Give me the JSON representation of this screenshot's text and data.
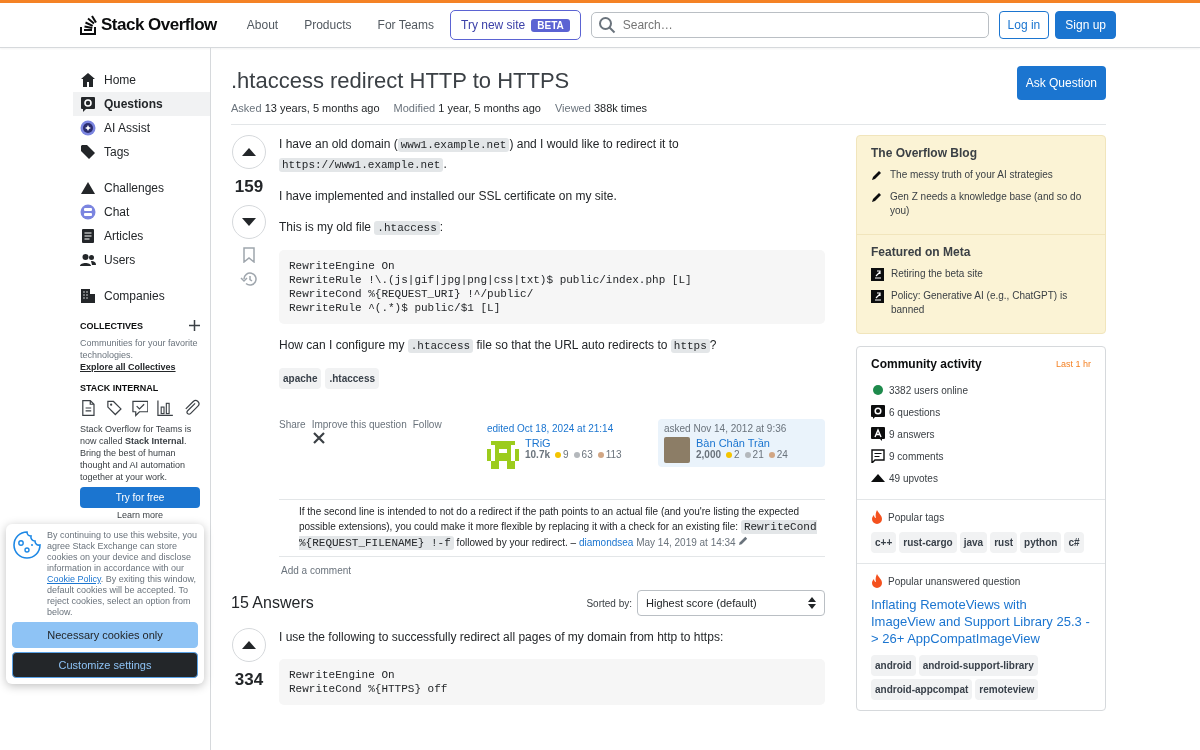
{
  "topbar": {
    "logo": "Stack Overflow",
    "nav": [
      "About",
      "Products",
      "For Teams"
    ],
    "try_button": {
      "label": "Try new site",
      "badge": "BETA"
    },
    "search": {
      "placeholder": "Search…"
    },
    "login": "Log in",
    "signup": "Sign up"
  },
  "sidebar": {
    "groups": [
      [
        {
          "kind": "home",
          "label": "Home",
          "selected": false
        },
        {
          "kind": "questions",
          "label": "Questions",
          "selected": true
        },
        {
          "kind": "ai",
          "label": "AI Assist",
          "selected": false
        },
        {
          "kind": "tags",
          "label": "Tags",
          "selected": false
        }
      ],
      [
        {
          "kind": "challenges",
          "label": "Challenges",
          "selected": false
        },
        {
          "kind": "chat",
          "label": "Chat",
          "selected": false
        },
        {
          "kind": "articles",
          "label": "Articles",
          "selected": false
        },
        {
          "kind": "users",
          "label": "Users",
          "selected": false
        }
      ],
      [
        {
          "kind": "companies",
          "label": "Companies",
          "selected": false
        }
      ]
    ],
    "collectives": {
      "heading": "COLLECTIVES",
      "text": "Communities for your favorite technologies.",
      "link": "Explore all Collectives"
    },
    "stack_internal": {
      "heading": "STACK INTERNAL",
      "text": "Stack Overflow for Teams is now called **Stack Internal**. Bring the best of human thought and AI automation together at your work.",
      "button": "Try for free",
      "link": "Learn more"
    }
  },
  "cookie": {
    "text": [
      {
        "kind": "text",
        "text": "By continuing to use this website, you agree Stack Exchange can store cookies on your device and disclose information in accordance with our "
      },
      {
        "kind": "link",
        "text": "Cookie Policy"
      },
      {
        "kind": "text",
        "text": ". By exiting this window, default cookies will be accepted. To reject cookies, select an option from below."
      }
    ],
    "buttons": [
      {
        "kind": "primary",
        "label": "Necessary cookies only"
      },
      {
        "kind": "dark",
        "label": "Customize settings"
      }
    ]
  },
  "question": {
    "title": ".htaccess redirect HTTP to HTTPS",
    "ask_button": "Ask Question",
    "meta": [
      {
        "label": "Asked",
        "value": "13 years, 5 months ago"
      },
      {
        "label": "Modified",
        "value": "1 year, 5 months ago"
      },
      {
        "label": "Viewed",
        "value": "388k times"
      }
    ],
    "score": "159",
    "body": [
      {
        "kind": "para",
        "parts": [
          {
            "kind": "text",
            "text": "I have an old domain ("
          },
          {
            "kind": "code",
            "text": "www1.example.net"
          },
          {
            "kind": "text",
            "text": ") and I would like to redirect it to "
          },
          {
            "kind": "code",
            "text": "https://www1.example.net"
          },
          {
            "kind": "text",
            "text": "."
          }
        ]
      },
      {
        "kind": "para",
        "parts": [
          {
            "kind": "text",
            "text": "I have implemented and installed our SSL certificate on my site."
          }
        ]
      },
      {
        "kind": "para",
        "parts": [
          {
            "kind": "text",
            "text": "This is my old file "
          },
          {
            "kind": "code",
            "text": ".htaccess"
          },
          {
            "kind": "text",
            "text": ":"
          }
        ]
      },
      {
        "kind": "code",
        "text": "RewriteEngine On\nRewriteRule !\\.(js|gif|jpg|png|css|txt)$ public/index.php [L]\nRewriteCond %{REQUEST_URI} !^/public/\nRewriteRule ^(.*)$ public/$1 [L]"
      },
      {
        "kind": "para",
        "parts": [
          {
            "kind": "text",
            "text": "How can I configure my "
          },
          {
            "kind": "code",
            "text": ".htaccess"
          },
          {
            "kind": "text",
            "text": " file so that the URL auto redirects to "
          },
          {
            "kind": "code",
            "text": "https"
          },
          {
            "kind": "text",
            "text": "?"
          }
        ]
      }
    ],
    "tags": [
      "apache",
      ".htaccess"
    ],
    "actions": [
      "Share",
      "Improve this question",
      "Follow"
    ],
    "edited": {
      "label": "edited Oct 18, 2024 at 21:14",
      "name": "TRiG",
      "rep": "10.7k",
      "gold": "9",
      "silver": "63",
      "bronze": "113"
    },
    "asked": {
      "label": "asked Nov 14, 2012 at 9:36",
      "name": "Bàn Chân Trần",
      "rep": "2,000",
      "gold": "2",
      "silver": "21",
      "bronze": "24"
    },
    "comments": [
      {
        "parts": [
          {
            "kind": "text",
            "text": "If the second line is intended to not do a redirect if the path points to an actual file (and you're listing the expected possible extensions), you could make it more flexible by replacing it with a check for an existing file: "
          },
          {
            "kind": "code",
            "text": "RewriteCond %{REQUEST_FILENAME} !-f"
          },
          {
            "kind": "text",
            "text": " followed by your redirect. – "
          }
        ],
        "author": "diamondsea",
        "date": "May 14, 2019 at 14:34"
      }
    ],
    "add_comment": "Add a comment"
  },
  "answers": {
    "heading": "15 Answers",
    "sort_label": "Sorted by:",
    "sort_value": "Highest score (default)",
    "first": {
      "score": "334",
      "text": "I use the following to successfully redirect all pages of my domain from http to https:",
      "code": "RewriteEngine On\nRewriteCond %{HTTPS} off"
    }
  },
  "right": {
    "blog": {
      "heading": "The Overflow Blog",
      "items": [
        "The messy truth of your AI strategies",
        "Gen Z needs a knowledge base (and so do you)"
      ]
    },
    "meta": {
      "heading": "Featured on Meta",
      "items": [
        "Retiring the beta site",
        "Policy: Generative AI (e.g., ChatGPT) is banned"
      ]
    },
    "activity": {
      "heading": "Community activity",
      "period": "Last 1 hr",
      "items": [
        {
          "kind": "online",
          "text": "3382 users online",
          "color": "#1e8a4c"
        },
        {
          "kind": "questions",
          "text": "6 questions"
        },
        {
          "kind": "answers",
          "text": "9 answers"
        },
        {
          "kind": "comments",
          "text": "9 comments"
        },
        {
          "kind": "upvotes",
          "text": "49 upvotes"
        }
      ]
    },
    "popular_tags": {
      "heading": "Popular tags",
      "tags": [
        "c++",
        "rust-cargo",
        "java",
        "rust",
        "python",
        "c#"
      ]
    },
    "unanswered": {
      "heading": "Popular unanswered question",
      "title": "Inflating RemoteViews with ImageView and Support Library 25.3 -> 26+ AppCompatImageView",
      "tags": [
        "android",
        "android-support-library",
        "android-appcompat",
        "remoteview"
      ]
    }
  }
}
